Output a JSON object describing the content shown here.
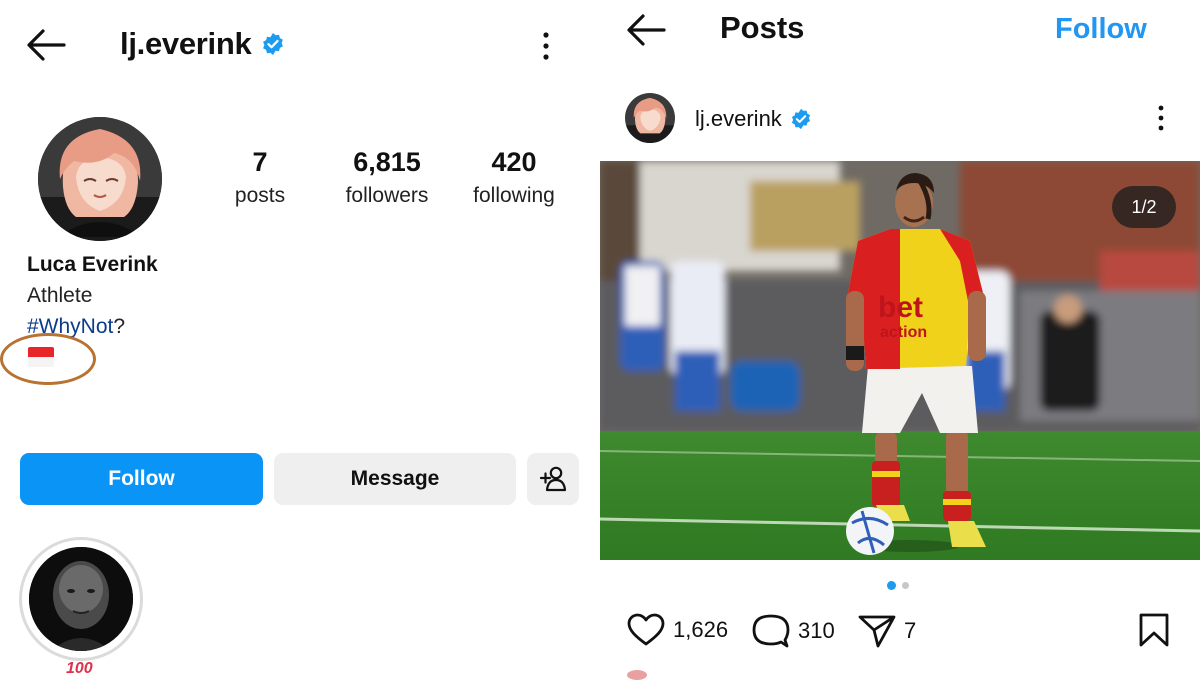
{
  "profile": {
    "username": "lj.everink",
    "verified": true,
    "stats": [
      {
        "value": "7",
        "label": "posts"
      },
      {
        "value": "6,815",
        "label": "followers"
      },
      {
        "value": "420",
        "label": "following"
      }
    ],
    "full_name": "Luca Everink",
    "category": "Athlete",
    "bio_hashtag": "#WhyNot",
    "bio_suffix": "?",
    "flag_icon": "indonesia-flag",
    "annotation_color": "#b87333",
    "follow_label": "Follow",
    "message_label": "Message",
    "add_friend_icon": "add-person-icon",
    "highlight_label": "100"
  },
  "post_view": {
    "title": "Posts",
    "follow_label": "Follow",
    "author": "lj.everink",
    "verified": true,
    "carousel_indicator": "1/2",
    "carousel_pages": 2,
    "carousel_active": 1,
    "likes": "1,626",
    "comments": "310",
    "shares": "7",
    "player_shirt_sponsor": "bet\naction"
  },
  "colors": {
    "accent": "#0a95f6",
    "verified": "#1d9bf0",
    "follow_text": "#2196f3"
  }
}
